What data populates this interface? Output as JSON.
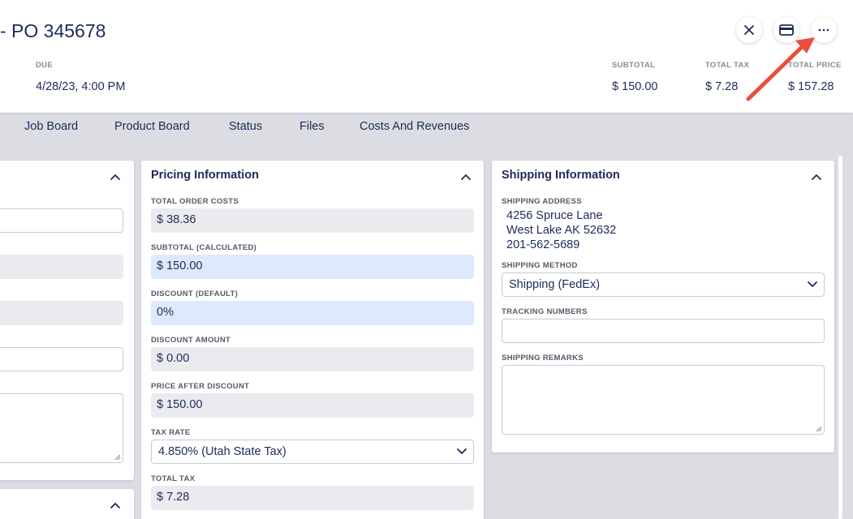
{
  "header": {
    "title": "- PO 345678",
    "due_label": "DUE",
    "due_value": "4/28/23, 4:00 PM",
    "subtotal_label": "SUBTOTAL",
    "subtotal_value": "$ 150.00",
    "total_tax_label": "TOTAL TAX",
    "total_tax_value": "$ 7.28",
    "total_price_label": "TOTAL PRICE",
    "total_price_value": "$ 157.28",
    "actions": [
      "close-icon",
      "credit-card-icon",
      "more-icon"
    ]
  },
  "tabs": [
    "Job Board",
    "Product Board",
    "Status",
    "Files",
    "Costs And Revenues"
  ],
  "pricing": {
    "title": "Pricing Information",
    "fields": [
      {
        "label": "TOTAL ORDER COSTS",
        "value": "$ 38.36"
      },
      {
        "label": "SUBTOTAL (CALCULATED)",
        "value": "$ 150.00"
      },
      {
        "label": "DISCOUNT (DEFAULT)",
        "value": "0%"
      },
      {
        "label": "DISCOUNT AMOUNT",
        "value": "$ 0.00"
      },
      {
        "label": "PRICE AFTER DISCOUNT",
        "value": "$ 150.00"
      },
      {
        "label": "TAX RATE",
        "value": "4.850% (Utah State Tax)"
      },
      {
        "label": "TOTAL TAX",
        "value": "$ 7.28"
      }
    ]
  },
  "shipping": {
    "title": "Shipping Information",
    "address_label": "SHIPPING ADDRESS",
    "address_lines": [
      "4256 Spruce Lane",
      "West Lake AK 52632",
      "201-562-5689"
    ],
    "method_label": "SHIPPING METHOD",
    "method_value": "Shipping (FedEx)",
    "tracking_label": "TRACKING NUMBERS",
    "tracking_value": "",
    "remarks_label": "SHIPPING REMARKS",
    "remarks_value": ""
  },
  "colors": {
    "navy": "#1e2a5a",
    "highlight_field": "#dde9fc",
    "readonly_field": "#ebebef",
    "background": "#dcdde3",
    "annotation_arrow": "#e8503a"
  }
}
